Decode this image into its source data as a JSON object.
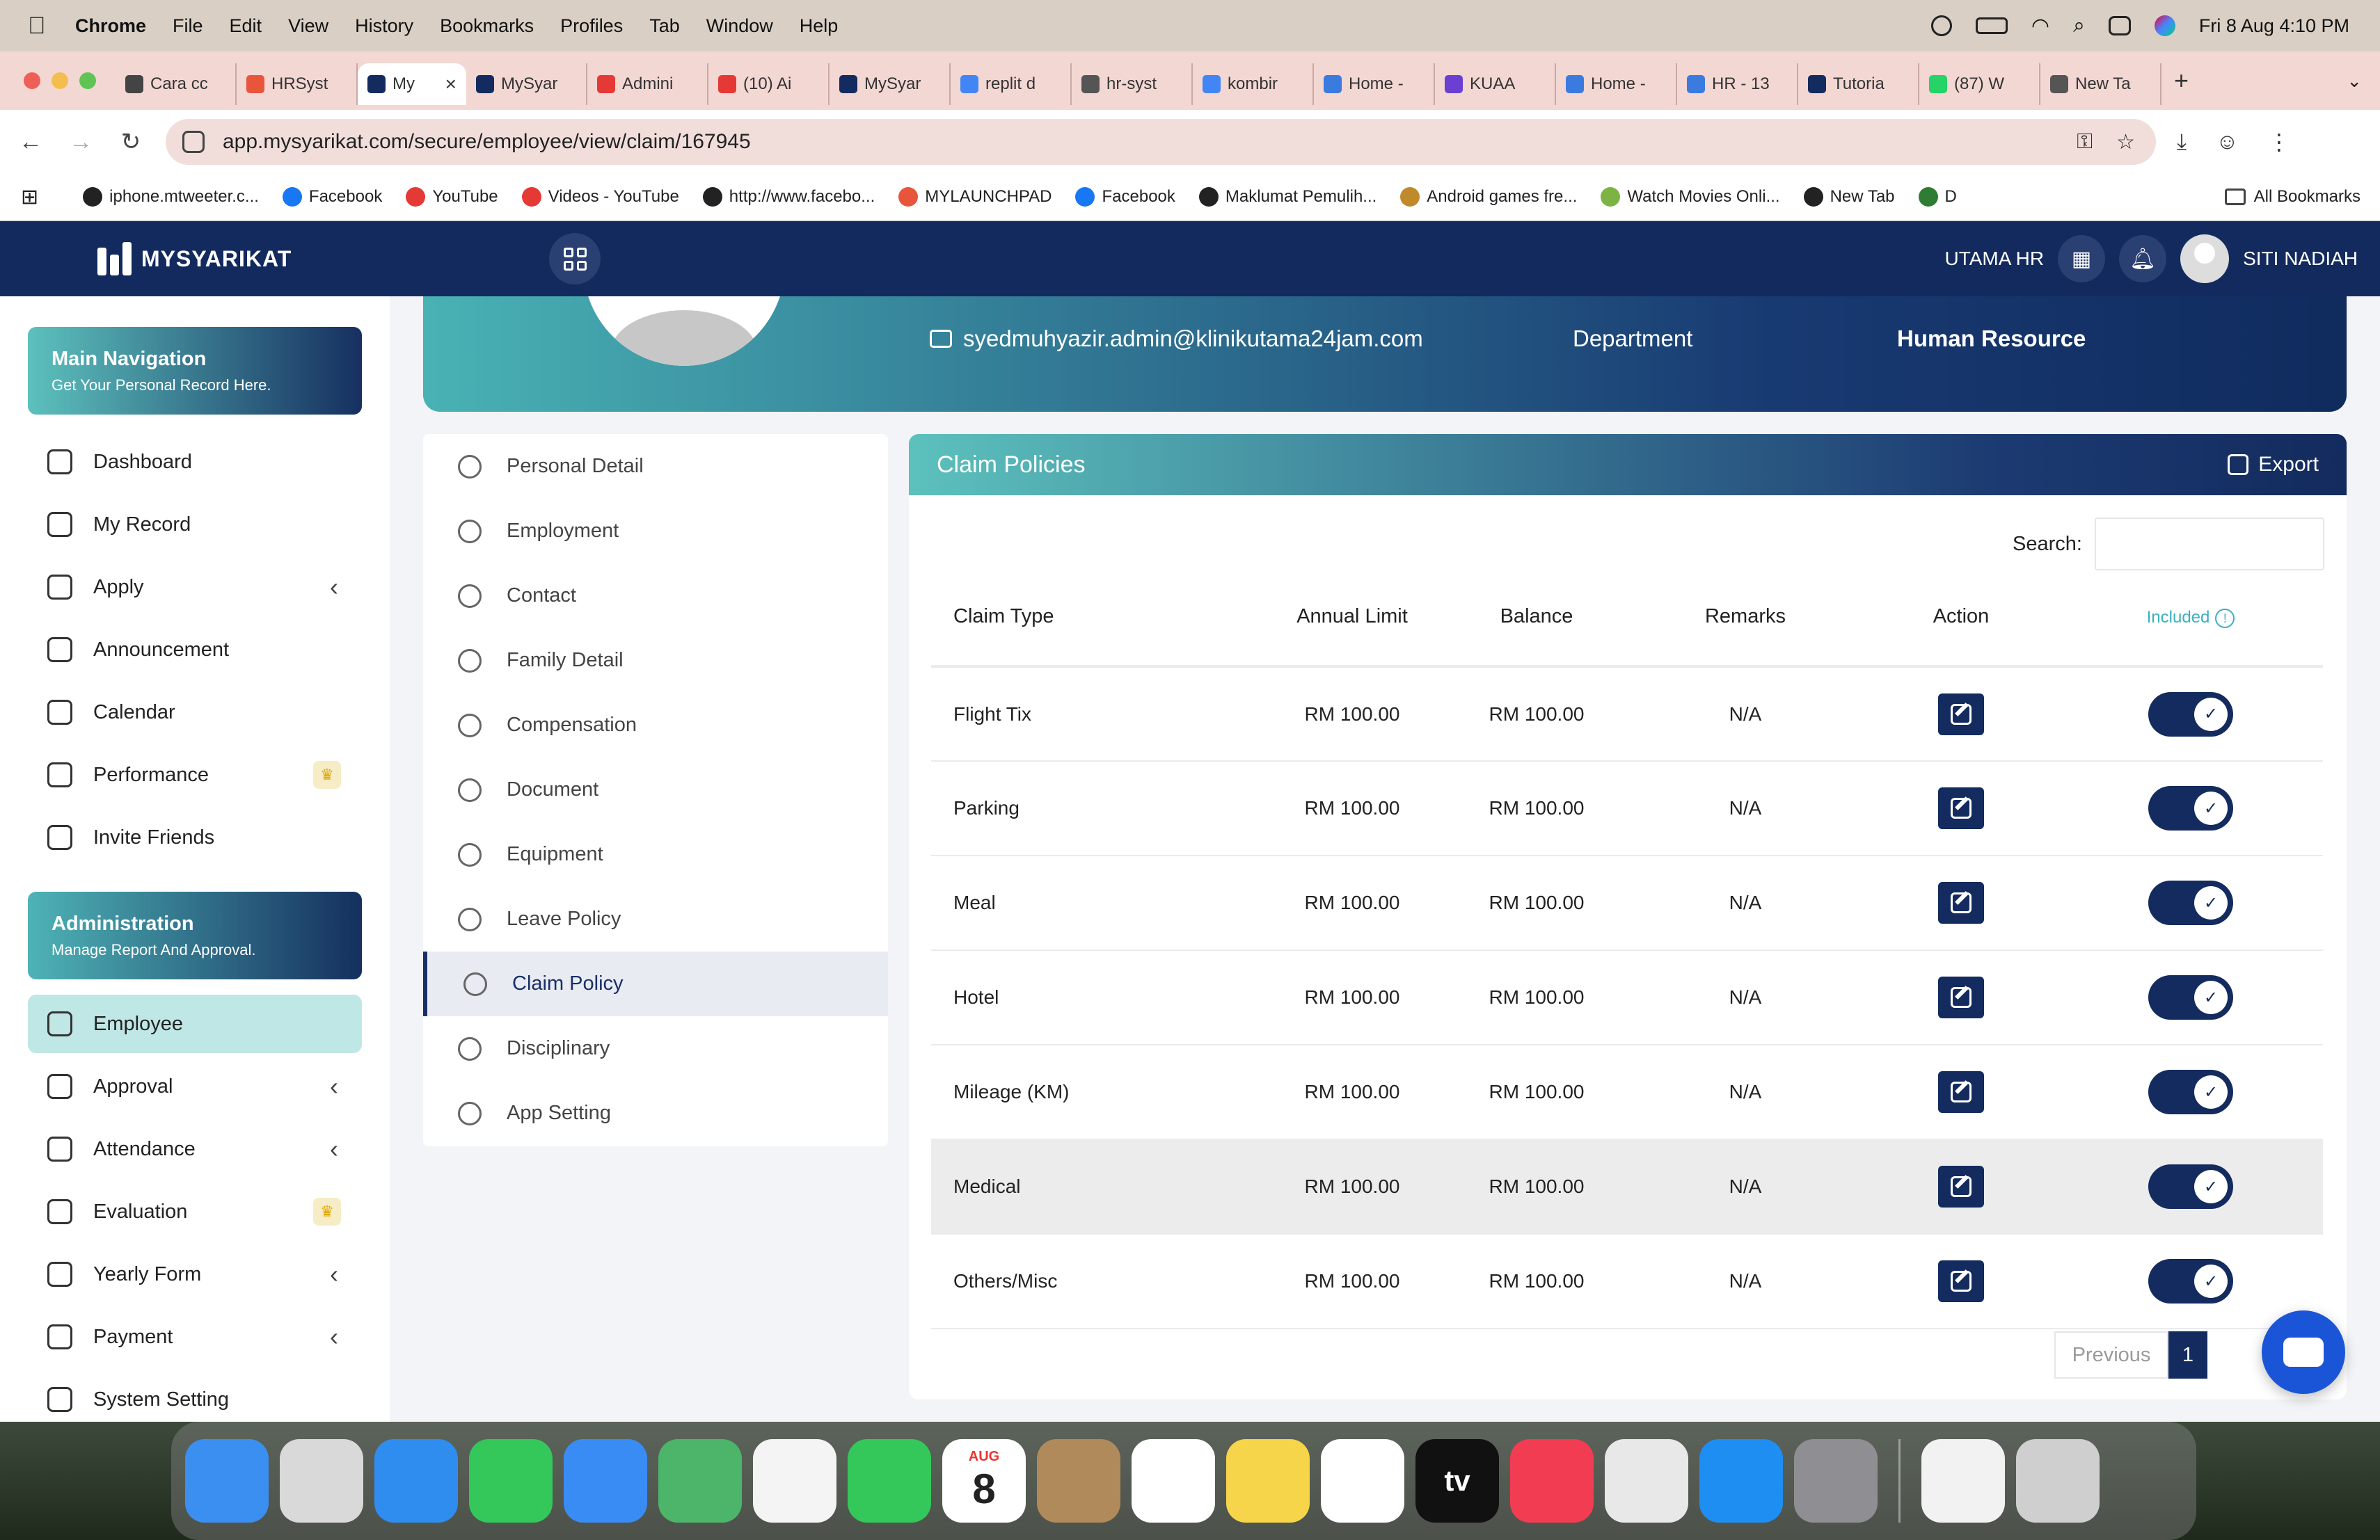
{
  "menubar": {
    "app": "Chrome",
    "items": [
      "File",
      "Edit",
      "View",
      "History",
      "Bookmarks",
      "Profiles",
      "Tab",
      "Window",
      "Help"
    ],
    "datetime": "Fri 8 Aug  4:10 PM"
  },
  "tabs": [
    {
      "label": "Cara cc",
      "color": "#444"
    },
    {
      "label": "HRSyst",
      "color": "#e8553b"
    },
    {
      "label": "My",
      "color": "#132b5e",
      "active": true
    },
    {
      "label": "MySyar",
      "color": "#132b5e"
    },
    {
      "label": "Admini",
      "color": "#e53935"
    },
    {
      "label": "(10) Ai",
      "color": "#e53935"
    },
    {
      "label": "MySyar",
      "color": "#132b5e"
    },
    {
      "label": "replit d",
      "color": "#4285f4"
    },
    {
      "label": "hr-syst",
      "color": "#555"
    },
    {
      "label": "kombir",
      "color": "#4285f4"
    },
    {
      "label": "Home -",
      "color": "#3b7be0"
    },
    {
      "label": "KUAA",
      "color": "#6a3fd1"
    },
    {
      "label": "Home -",
      "color": "#3b7be0"
    },
    {
      "label": "HR - 13",
      "color": "#3b7be0"
    },
    {
      "label": "Tutoria",
      "color": "#132b5e"
    },
    {
      "label": "(87) W",
      "color": "#25d366"
    },
    {
      "label": "New Ta",
      "color": "#555"
    }
  ],
  "address": {
    "url": "app.mysyarikat.com/secure/employee/view/claim/167945"
  },
  "bookmarks": [
    {
      "label": "iphone.mtweeter.c...",
      "color": "#222"
    },
    {
      "label": "Facebook",
      "color": "#1877f2"
    },
    {
      "label": "YouTube",
      "color": "#e53935"
    },
    {
      "label": "Videos - YouTube",
      "color": "#e53935"
    },
    {
      "label": "http://www.facebo...",
      "color": "#222"
    },
    {
      "label": "MYLAUNCHPAD",
      "color": "#e8553b"
    },
    {
      "label": "Facebook",
      "color": "#1877f2"
    },
    {
      "label": "Maklumat Pemulih...",
      "color": "#222"
    },
    {
      "label": "Android games fre...",
      "color": "#c08a2b"
    },
    {
      "label": "Watch Movies Onli...",
      "color": "#7cb342"
    },
    {
      "label": "New Tab",
      "color": "#222"
    },
    {
      "label": "D",
      "color": "#2e7d32"
    }
  ],
  "all_bookmarks": "All Bookmarks",
  "header": {
    "brand": "MYSYARIKAT",
    "company": "UTAMA HR",
    "user": "SITI NADIAH"
  },
  "sidebar": {
    "main_card": {
      "title": "Main Navigation",
      "subtitle": "Get Your Personal Record Here."
    },
    "main_items": [
      {
        "label": "Dashboard",
        "chevron": false,
        "crown": false
      },
      {
        "label": "My Record",
        "chevron": false,
        "crown": false
      },
      {
        "label": "Apply",
        "chevron": true,
        "crown": false
      },
      {
        "label": "Announcement",
        "chevron": false,
        "crown": false
      },
      {
        "label": "Calendar",
        "chevron": false,
        "crown": false
      },
      {
        "label": "Performance",
        "chevron": false,
        "crown": true
      },
      {
        "label": "Invite Friends",
        "chevron": false,
        "crown": false
      }
    ],
    "admin_card": {
      "title": "Administration",
      "subtitle": "Manage Report And Approval."
    },
    "admin_items": [
      {
        "label": "Employee",
        "chevron": false,
        "crown": false,
        "active": true
      },
      {
        "label": "Approval",
        "chevron": true,
        "crown": false
      },
      {
        "label": "Attendance",
        "chevron": true,
        "crown": false
      },
      {
        "label": "Evaluation",
        "chevron": false,
        "crown": true
      },
      {
        "label": "Yearly Form",
        "chevron": true,
        "crown": false
      },
      {
        "label": "Payment",
        "chevron": true,
        "crown": false
      },
      {
        "label": "System Setting",
        "chevron": false,
        "crown": false
      }
    ]
  },
  "profile": {
    "email": "syedmuhyazir.admin@klinikutama24jam.com",
    "department_label": "Department",
    "department_value": "Human Resource"
  },
  "submenu": [
    {
      "label": "Personal Detail"
    },
    {
      "label": "Employment"
    },
    {
      "label": "Contact"
    },
    {
      "label": "Family Detail"
    },
    {
      "label": "Compensation"
    },
    {
      "label": "Document"
    },
    {
      "label": "Equipment"
    },
    {
      "label": "Leave Policy"
    },
    {
      "label": "Claim Policy",
      "active": true
    },
    {
      "label": "Disciplinary"
    },
    {
      "label": "App Setting"
    }
  ],
  "panel": {
    "title": "Claim Policies",
    "export_label": "Export",
    "search_label": "Search:",
    "columns": [
      "Claim Type",
      "Annual Limit",
      "Balance",
      "Remarks",
      "Action",
      "Included"
    ],
    "rows": [
      {
        "type": "Flight Tix",
        "limit": "RM 100.00",
        "balance": "RM 100.00",
        "remarks": "N/A",
        "included": true
      },
      {
        "type": "Parking",
        "limit": "RM 100.00",
        "balance": "RM 100.00",
        "remarks": "N/A",
        "included": true
      },
      {
        "type": "Meal",
        "limit": "RM 100.00",
        "balance": "RM 100.00",
        "remarks": "N/A",
        "included": true
      },
      {
        "type": "Hotel",
        "limit": "RM 100.00",
        "balance": "RM 100.00",
        "remarks": "N/A",
        "included": true
      },
      {
        "type": "Mileage (KM)",
        "limit": "RM 100.00",
        "balance": "RM 100.00",
        "remarks": "N/A",
        "included": true
      },
      {
        "type": "Medical",
        "limit": "RM 100.00",
        "balance": "RM 100.00",
        "remarks": "N/A",
        "included": true,
        "highlight": true
      },
      {
        "type": "Others/Misc",
        "limit": "RM 100.00",
        "balance": "RM 100.00",
        "remarks": "N/A",
        "included": true
      }
    ],
    "pagination": {
      "previous": "Previous",
      "current": "1"
    }
  },
  "dock": [
    {
      "name": "finder",
      "color": "#3b8ff0"
    },
    {
      "name": "launchpad",
      "color": "#d9d9d9"
    },
    {
      "name": "safari",
      "color": "#2f8df0"
    },
    {
      "name": "messages",
      "color": "#34c759"
    },
    {
      "name": "mail",
      "color": "#3a8cf5"
    },
    {
      "name": "maps",
      "color": "#4cb56a"
    },
    {
      "name": "photos",
      "color": "#f4f4f4"
    },
    {
      "name": "facetime",
      "color": "#34c759"
    },
    {
      "name": "calendar",
      "color": "#ffffff",
      "text": "8"
    },
    {
      "name": "contacts",
      "color": "#b08a5a"
    },
    {
      "name": "reminders",
      "color": "#ffffff"
    },
    {
      "name": "notes",
      "color": "#f7d54a"
    },
    {
      "name": "freeform",
      "color": "#ffffff"
    },
    {
      "name": "tv",
      "color": "#111111",
      "text": "tv"
    },
    {
      "name": "music",
      "color": "#f23c52"
    },
    {
      "name": "chrome",
      "color": "#e8e8e8"
    },
    {
      "name": "app-store",
      "color": "#1f8ef2"
    },
    {
      "name": "system-settings",
      "color": "#8e8e93"
    },
    {
      "name": "document",
      "color": "#f2f2f2"
    },
    {
      "name": "trash",
      "color": "#cfcfcf"
    }
  ],
  "dock_calendar_month": "AUG"
}
